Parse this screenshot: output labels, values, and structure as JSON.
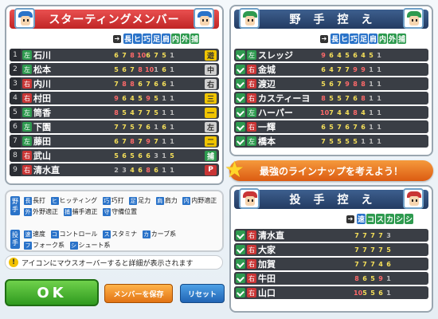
{
  "starting": {
    "title": "スターティングメンバー",
    "columns": [
      "長",
      "ヒ",
      "巧",
      "足",
      "肩",
      "内",
      "外",
      "捕"
    ],
    "column_colors": [
      "#2a73c9",
      "#2a73c9",
      "#2a73c9",
      "#2a73c9",
      "#2a73c9",
      "#2e9a4f",
      "#2e9a4f",
      "#2e9a4f"
    ],
    "rows": [
      {
        "num": "1",
        "hand": "左",
        "name": "石川",
        "stats": [
          "6",
          "7",
          "8",
          "10",
          "6",
          "7",
          "5",
          "1"
        ],
        "pos": "遊",
        "pos_bg": "#f0c400",
        "pos_fg": "#333"
      },
      {
        "num": "2",
        "hand": "左",
        "name": "松本",
        "stats": [
          "5",
          "6",
          "7",
          "8",
          "10",
          "1",
          "6",
          "1"
        ],
        "pos": "中",
        "pos_bg": "#cfcfcf",
        "pos_fg": "#333"
      },
      {
        "num": "3",
        "hand": "右",
        "name": "内川",
        "stats": [
          "7",
          "8",
          "8",
          "6",
          "7",
          "6",
          "6",
          "1"
        ],
        "pos": "右",
        "pos_bg": "#cfcfcf",
        "pos_fg": "#333"
      },
      {
        "num": "4",
        "hand": "右",
        "name": "村田",
        "stats": [
          "9",
          "6",
          "4",
          "5",
          "9",
          "5",
          "1",
          "1"
        ],
        "pos": "三",
        "pos_bg": "#f0c400",
        "pos_fg": "#333"
      },
      {
        "num": "5",
        "hand": "左",
        "name": "筒香",
        "stats": [
          "8",
          "5",
          "4",
          "7",
          "7",
          "5",
          "1",
          "1"
        ],
        "pos": "一",
        "pos_bg": "#f0c400",
        "pos_fg": "#333"
      },
      {
        "num": "6",
        "hand": "左",
        "name": "下園",
        "stats": [
          "7",
          "7",
          "5",
          "7",
          "6",
          "1",
          "6",
          "1"
        ],
        "pos": "左",
        "pos_bg": "#cfcfcf",
        "pos_fg": "#333"
      },
      {
        "num": "7",
        "hand": "左",
        "name": "藤田",
        "stats": [
          "6",
          "7",
          "8",
          "7",
          "9",
          "7",
          "1",
          "1"
        ],
        "pos": "二",
        "pos_bg": "#f0c400",
        "pos_fg": "#333"
      },
      {
        "num": "8",
        "hand": "右",
        "name": "武山",
        "stats": [
          "5",
          "6",
          "5",
          "6",
          "6",
          "3",
          "1",
          "5"
        ],
        "pos": "捕",
        "pos_bg": "#2e9a4f",
        "pos_fg": "#fff"
      },
      {
        "num": "9",
        "hand": "右",
        "name": "清水直",
        "stats": [
          "2",
          "3",
          "4",
          "6",
          "8",
          "6",
          "1",
          "1"
        ],
        "pos": "P",
        "pos_bg": "#c93535",
        "pos_fg": "#fff"
      }
    ]
  },
  "fielders_bench": {
    "title": "野　手　控　え",
    "columns": [
      "長",
      "ヒ",
      "巧",
      "足",
      "肩",
      "内",
      "外",
      "捕"
    ],
    "column_colors": [
      "#2a73c9",
      "#2a73c9",
      "#2a73c9",
      "#2a73c9",
      "#2a73c9",
      "#2e9a4f",
      "#2e9a4f",
      "#2e9a4f"
    ],
    "rows": [
      {
        "hand": "左",
        "name": "スレッジ",
        "stats": [
          "9",
          "6",
          "4",
          "5",
          "6",
          "4",
          "5",
          "1"
        ]
      },
      {
        "hand": "右",
        "name": "金城",
        "stats": [
          "6",
          "4",
          "7",
          "7",
          "9",
          "9",
          "1",
          "1"
        ]
      },
      {
        "hand": "右",
        "name": "渡辺",
        "stats": [
          "5",
          "6",
          "7",
          "9",
          "8",
          "8",
          "1",
          "1"
        ]
      },
      {
        "hand": "右",
        "name": "カスティーヨ",
        "stats": [
          "8",
          "5",
          "5",
          "7",
          "6",
          "8",
          "1",
          "1"
        ]
      },
      {
        "hand": "左",
        "name": "ハーパー",
        "stats": [
          "10",
          "7",
          "4",
          "4",
          "8",
          "4",
          "1",
          "1"
        ]
      },
      {
        "hand": "右",
        "name": "一輝",
        "stats": [
          "6",
          "5",
          "7",
          "6",
          "7",
          "6",
          "1",
          "1"
        ]
      },
      {
        "hand": "左",
        "name": "橋本",
        "stats": [
          "7",
          "5",
          "5",
          "5",
          "5",
          "1",
          "1",
          "1"
        ]
      }
    ]
  },
  "banner": {
    "text": "最強のラインナップを考えよう！"
  },
  "pitchers_bench": {
    "title": "投　手　控　え",
    "columns": [
      "速",
      "コ",
      "ス",
      "カ",
      "シ",
      "シ"
    ],
    "column_colors": [
      "#2a73c9",
      "#2e9a4f",
      "#2e9a4f",
      "#2e9a4f",
      "#2e9a4f",
      "#2e9a4f"
    ],
    "rows": [
      {
        "hand": "右",
        "name": "清水直",
        "stats": [
          "7",
          "7",
          "7",
          "7",
          "3"
        ]
      },
      {
        "hand": "右",
        "name": "大家",
        "stats": [
          "7",
          "7",
          "7",
          "7",
          "5"
        ]
      },
      {
        "hand": "右",
        "name": "加賀",
        "stats": [
          "7",
          "7",
          "7",
          "4",
          "6"
        ]
      },
      {
        "hand": "右",
        "name": "牛田",
        "stats": [
          "8",
          "6",
          "5",
          "9",
          "1"
        ]
      },
      {
        "hand": "右",
        "name": "山口",
        "stats": [
          "10",
          "5",
          "5",
          "6",
          "1"
        ]
      }
    ]
  },
  "legend": {
    "fielder_label": "野手",
    "pitcher_label": "投手",
    "fielder_items": [
      {
        "tag": "長",
        "text": "長打"
      },
      {
        "tag": "ヒ",
        "text": "ヒッティング"
      },
      {
        "tag": "巧",
        "text": "巧打"
      },
      {
        "tag": "足",
        "text": "足力"
      },
      {
        "tag": "肩",
        "text": "肩力"
      },
      {
        "tag": "内",
        "text": "内野適正"
      },
      {
        "tag": "外",
        "text": "外野適正"
      },
      {
        "tag": "捕",
        "text": "捕手適正"
      },
      {
        "tag": "守",
        "text": "守備位置"
      }
    ],
    "pitcher_items": [
      {
        "tag": "速",
        "text": "速度"
      },
      {
        "tag": "コ",
        "text": "コントロール"
      },
      {
        "tag": "ス",
        "text": "スタミナ"
      },
      {
        "tag": "カ",
        "text": "カーブ系"
      },
      {
        "tag": "フ",
        "text": "フォーク系"
      },
      {
        "tag": "シ",
        "text": "シュート系"
      }
    ]
  },
  "notice": {
    "text": "アイコンにマウスオーバーすると詳細が表示されます"
  },
  "buttons": {
    "ok": "OK",
    "save": "メンバーを保存",
    "reset": "リセット"
  },
  "colors": {
    "left_hand": "#2e9a4f",
    "right_hand": "#c93535",
    "stat_high": "#ff6a6a",
    "stat_mid": "#f6e05a",
    "stat_low": "#bdbdbd"
  }
}
